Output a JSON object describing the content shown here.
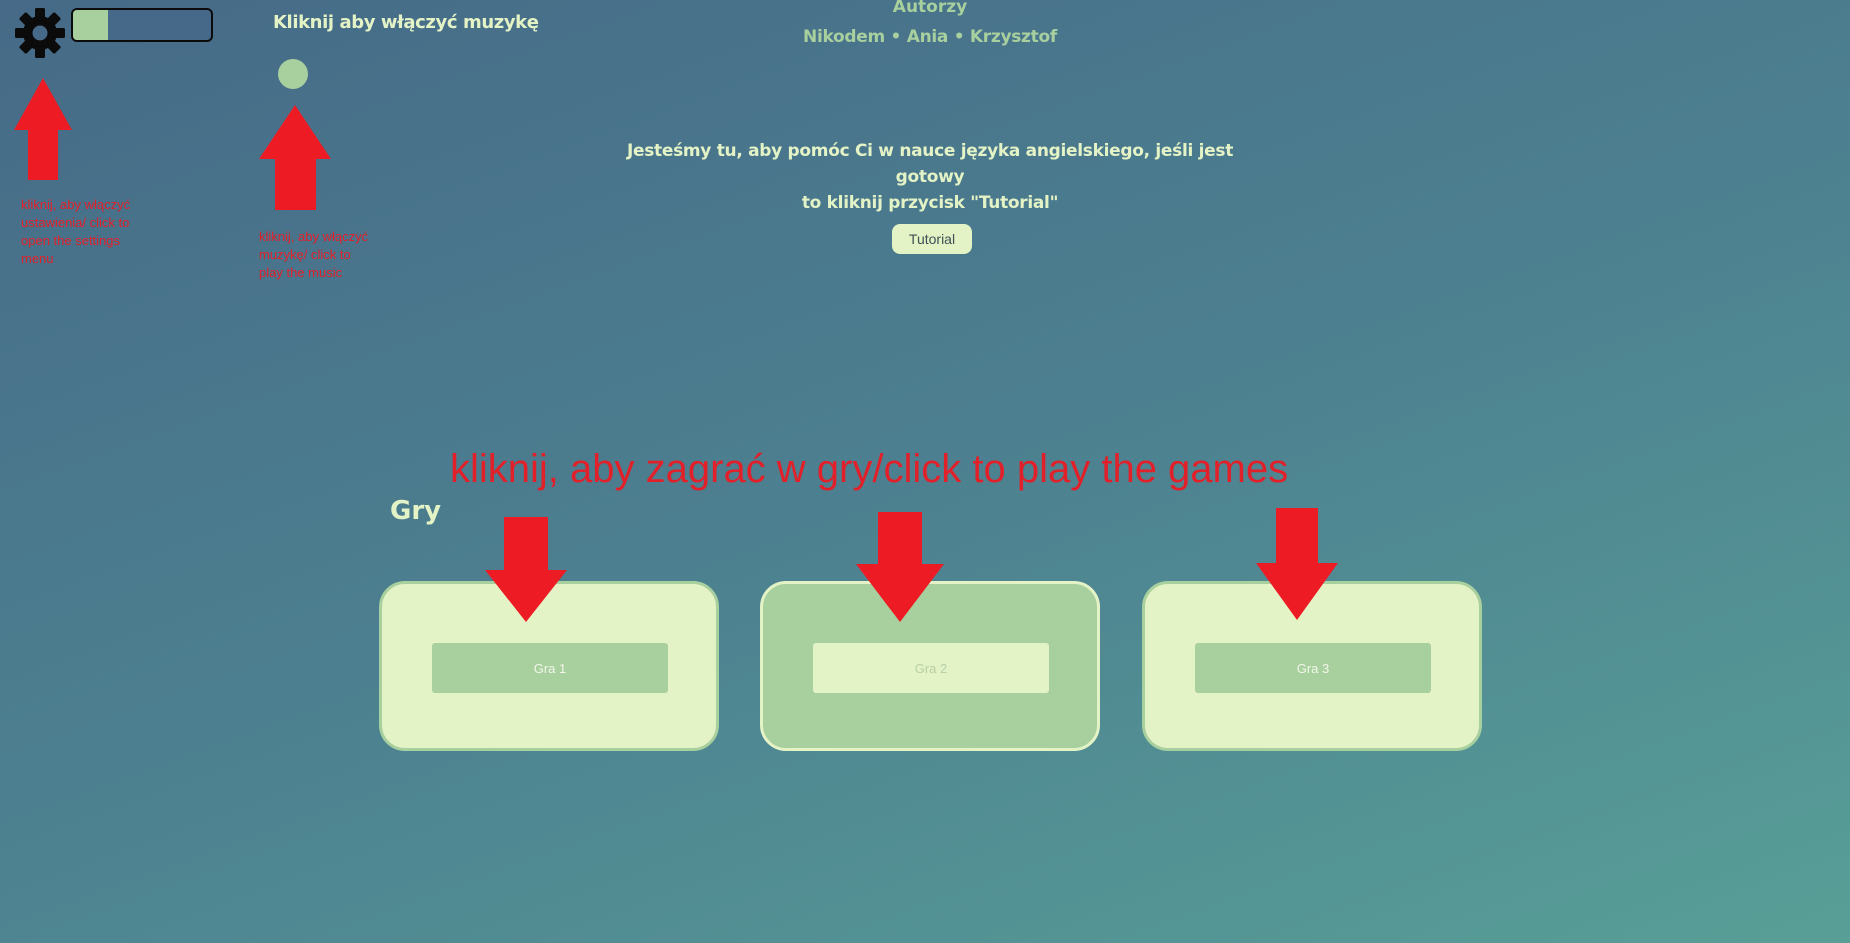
{
  "settings": {
    "icon": "gear-icon",
    "volume_fill_percent": 25,
    "annotation": "kliknij, aby włączyć ustawienia/ click to open the settings menu"
  },
  "music": {
    "label": "Kliknij aby włączyć muzykę",
    "annotation": "kliknij, aby włączyć muzykę/ click to play the music"
  },
  "authors": {
    "title": "Autorzy",
    "names": "Nikodem • Ania • Krzysztof"
  },
  "intro": {
    "line1": "Jesteśmy tu, aby pomóc Ci w nauce języka angielskiego, jeśli jest gotowy",
    "line2": "to kliknij przycisk \"Tutorial\""
  },
  "tutorial_button": "Tutorial",
  "games": {
    "annotation": "kliknij, aby zagrać w gry/click to play the games",
    "heading": "Gry",
    "items": [
      {
        "label": "Gra 1"
      },
      {
        "label": "Gra 2"
      },
      {
        "label": "Gra 3"
      }
    ]
  },
  "colors": {
    "light_green": "#e4f3c6",
    "mid_green": "#a8cf9e",
    "annotation_red": "#ed1c24"
  }
}
